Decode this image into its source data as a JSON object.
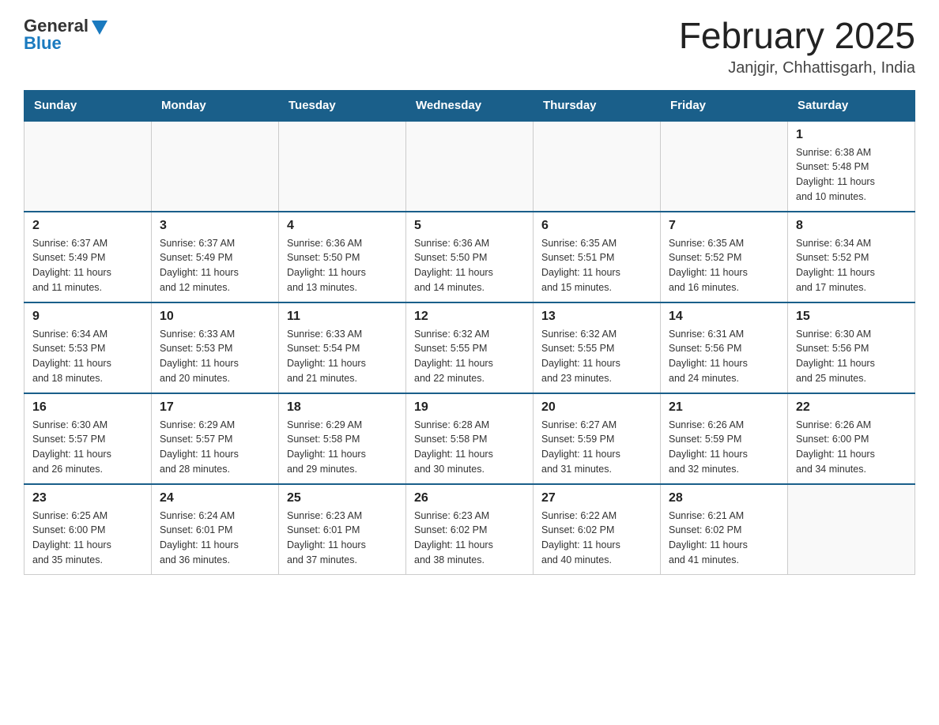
{
  "header": {
    "logo_general": "General",
    "logo_blue": "Blue",
    "title": "February 2025",
    "subtitle": "Janjgir, Chhattisgarh, India"
  },
  "weekdays": [
    "Sunday",
    "Monday",
    "Tuesday",
    "Wednesday",
    "Thursday",
    "Friday",
    "Saturday"
  ],
  "weeks": [
    [
      {
        "day": "",
        "info": ""
      },
      {
        "day": "",
        "info": ""
      },
      {
        "day": "",
        "info": ""
      },
      {
        "day": "",
        "info": ""
      },
      {
        "day": "",
        "info": ""
      },
      {
        "day": "",
        "info": ""
      },
      {
        "day": "1",
        "info": "Sunrise: 6:38 AM\nSunset: 5:48 PM\nDaylight: 11 hours\nand 10 minutes."
      }
    ],
    [
      {
        "day": "2",
        "info": "Sunrise: 6:37 AM\nSunset: 5:49 PM\nDaylight: 11 hours\nand 11 minutes."
      },
      {
        "day": "3",
        "info": "Sunrise: 6:37 AM\nSunset: 5:49 PM\nDaylight: 11 hours\nand 12 minutes."
      },
      {
        "day": "4",
        "info": "Sunrise: 6:36 AM\nSunset: 5:50 PM\nDaylight: 11 hours\nand 13 minutes."
      },
      {
        "day": "5",
        "info": "Sunrise: 6:36 AM\nSunset: 5:50 PM\nDaylight: 11 hours\nand 14 minutes."
      },
      {
        "day": "6",
        "info": "Sunrise: 6:35 AM\nSunset: 5:51 PM\nDaylight: 11 hours\nand 15 minutes."
      },
      {
        "day": "7",
        "info": "Sunrise: 6:35 AM\nSunset: 5:52 PM\nDaylight: 11 hours\nand 16 minutes."
      },
      {
        "day": "8",
        "info": "Sunrise: 6:34 AM\nSunset: 5:52 PM\nDaylight: 11 hours\nand 17 minutes."
      }
    ],
    [
      {
        "day": "9",
        "info": "Sunrise: 6:34 AM\nSunset: 5:53 PM\nDaylight: 11 hours\nand 18 minutes."
      },
      {
        "day": "10",
        "info": "Sunrise: 6:33 AM\nSunset: 5:53 PM\nDaylight: 11 hours\nand 20 minutes."
      },
      {
        "day": "11",
        "info": "Sunrise: 6:33 AM\nSunset: 5:54 PM\nDaylight: 11 hours\nand 21 minutes."
      },
      {
        "day": "12",
        "info": "Sunrise: 6:32 AM\nSunset: 5:55 PM\nDaylight: 11 hours\nand 22 minutes."
      },
      {
        "day": "13",
        "info": "Sunrise: 6:32 AM\nSunset: 5:55 PM\nDaylight: 11 hours\nand 23 minutes."
      },
      {
        "day": "14",
        "info": "Sunrise: 6:31 AM\nSunset: 5:56 PM\nDaylight: 11 hours\nand 24 minutes."
      },
      {
        "day": "15",
        "info": "Sunrise: 6:30 AM\nSunset: 5:56 PM\nDaylight: 11 hours\nand 25 minutes."
      }
    ],
    [
      {
        "day": "16",
        "info": "Sunrise: 6:30 AM\nSunset: 5:57 PM\nDaylight: 11 hours\nand 26 minutes."
      },
      {
        "day": "17",
        "info": "Sunrise: 6:29 AM\nSunset: 5:57 PM\nDaylight: 11 hours\nand 28 minutes."
      },
      {
        "day": "18",
        "info": "Sunrise: 6:29 AM\nSunset: 5:58 PM\nDaylight: 11 hours\nand 29 minutes."
      },
      {
        "day": "19",
        "info": "Sunrise: 6:28 AM\nSunset: 5:58 PM\nDaylight: 11 hours\nand 30 minutes."
      },
      {
        "day": "20",
        "info": "Sunrise: 6:27 AM\nSunset: 5:59 PM\nDaylight: 11 hours\nand 31 minutes."
      },
      {
        "day": "21",
        "info": "Sunrise: 6:26 AM\nSunset: 5:59 PM\nDaylight: 11 hours\nand 32 minutes."
      },
      {
        "day": "22",
        "info": "Sunrise: 6:26 AM\nSunset: 6:00 PM\nDaylight: 11 hours\nand 34 minutes."
      }
    ],
    [
      {
        "day": "23",
        "info": "Sunrise: 6:25 AM\nSunset: 6:00 PM\nDaylight: 11 hours\nand 35 minutes."
      },
      {
        "day": "24",
        "info": "Sunrise: 6:24 AM\nSunset: 6:01 PM\nDaylight: 11 hours\nand 36 minutes."
      },
      {
        "day": "25",
        "info": "Sunrise: 6:23 AM\nSunset: 6:01 PM\nDaylight: 11 hours\nand 37 minutes."
      },
      {
        "day": "26",
        "info": "Sunrise: 6:23 AM\nSunset: 6:02 PM\nDaylight: 11 hours\nand 38 minutes."
      },
      {
        "day": "27",
        "info": "Sunrise: 6:22 AM\nSunset: 6:02 PM\nDaylight: 11 hours\nand 40 minutes."
      },
      {
        "day": "28",
        "info": "Sunrise: 6:21 AM\nSunset: 6:02 PM\nDaylight: 11 hours\nand 41 minutes."
      },
      {
        "day": "",
        "info": ""
      }
    ]
  ]
}
